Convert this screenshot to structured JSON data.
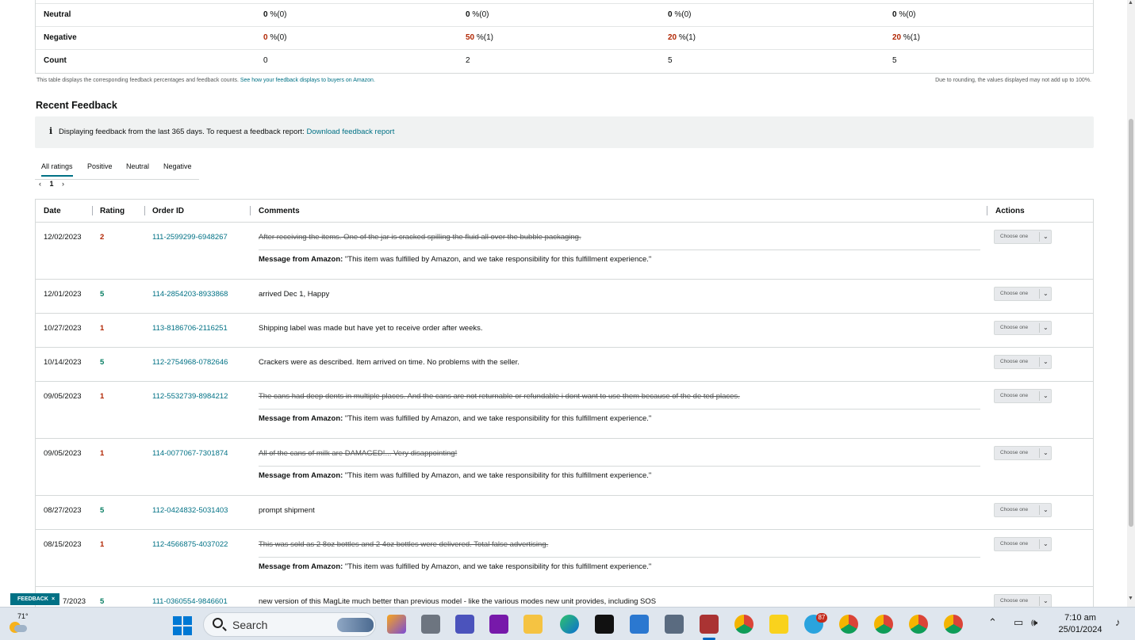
{
  "summary": {
    "rows": [
      {
        "label": "Neutral",
        "cells": [
          {
            "num": "0",
            "rest": " %(0)",
            "neg": false
          },
          {
            "num": "0",
            "rest": " %(0)",
            "neg": false
          },
          {
            "num": "0",
            "rest": " %(0)",
            "neg": false
          },
          {
            "num": "0",
            "rest": " %(0)",
            "neg": false
          }
        ]
      },
      {
        "label": "Negative",
        "cells": [
          {
            "num": "0",
            "rest": " %(0)",
            "neg": true
          },
          {
            "num": "50",
            "rest": " %(1)",
            "neg": true
          },
          {
            "num": "20",
            "rest": " %(1)",
            "neg": true
          },
          {
            "num": "20",
            "rest": " %(1)",
            "neg": true
          }
        ]
      },
      {
        "label": "Count",
        "cells": [
          {
            "num": "0",
            "rest": "",
            "neg": false
          },
          {
            "num": "2",
            "rest": "",
            "neg": false
          },
          {
            "num": "5",
            "rest": "",
            "neg": false
          },
          {
            "num": "5",
            "rest": "",
            "neg": false
          }
        ]
      }
    ],
    "note_left": "This table displays the corresponding feedback percentages and feedback counts.",
    "note_left_link": "See how your feedback displays to buyers on Amazon.",
    "note_right": "Due to rounding, the values displayed may not add up to 100%."
  },
  "recent": {
    "title": "Recent Feedback",
    "info_text": "Displaying feedback from the last 365 days. To request a feedback report:",
    "info_link": "Download feedback report",
    "tabs": [
      "All ratings",
      "Positive",
      "Neutral",
      "Negative"
    ],
    "active_tab": "All ratings",
    "pager": {
      "prev": "‹",
      "page": "1",
      "next": "›"
    }
  },
  "table": {
    "headers": {
      "date": "Date",
      "rating": "Rating",
      "order": "Order ID",
      "comments": "Comments",
      "actions": "Actions"
    },
    "action_label": "Choose one",
    "message_label": "Message from Amazon:",
    "rows": [
      {
        "date": "12/02/2023",
        "rating": "2",
        "order": "111-2599299-6948267",
        "comment": "After receiving the items. One of the jar is cracked spilling the fluid all over the bubble packaging.",
        "struck": true,
        "message": "\"This item was fulfilled by Amazon, and we take responsibility for this fulfillment experience.\""
      },
      {
        "date": "12/01/2023",
        "rating": "5",
        "order": "114-2854203-8933868",
        "comment": "arrived Dec 1, Happy",
        "struck": false,
        "message": ""
      },
      {
        "date": "10/27/2023",
        "rating": "1",
        "order": "113-8186706-2116251",
        "comment": "Shipping label was made but have yet to receive order after weeks.",
        "struck": false,
        "message": ""
      },
      {
        "date": "10/14/2023",
        "rating": "5",
        "order": "112-2754968-0782646",
        "comment": "Crackers were as described. Item arrived on time. No problems with the seller.",
        "struck": false,
        "message": ""
      },
      {
        "date": "09/05/2023",
        "rating": "1",
        "order": "112-5532739-8984212",
        "comment": "The cans had deep dents in multiple places. And the cans are not returnable or refundable i dont want to use them because of the de ted places.",
        "struck": true,
        "message": "\"This item was fulfilled by Amazon, and we take responsibility for this fulfillment experience.\""
      },
      {
        "date": "09/05/2023",
        "rating": "1",
        "order": "114-0077067-7301874",
        "comment": "All of the cans of milk are DAMAGED!... Very disappointing!",
        "struck": true,
        "message": "\"This item was fulfilled by Amazon, and we take responsibility for this fulfillment experience.\""
      },
      {
        "date": "08/27/2023",
        "rating": "5",
        "order": "112-0424832-5031403",
        "comment": "prompt shipment",
        "struck": false,
        "message": ""
      },
      {
        "date": "08/15/2023",
        "rating": "1",
        "order": "112-4566875-4037022",
        "comment": "This was sold as 2 8oz bottles and 2 4oz bottles were delivered. Total false advertising.",
        "struck": true,
        "message": "\"This item was fulfilled by Amazon, and we take responsibility for this fulfillment experience.\""
      },
      {
        "date": "7/2023",
        "rating": "5",
        "order": "111-0360554-9846601",
        "comment": "new version of this MagLite much better than previous model - like the various modes new unit provides, including SOS",
        "struck": false,
        "message": ""
      }
    ]
  },
  "feedback_tab": {
    "label": "FEEDBACK",
    "close": "×"
  },
  "taskbar": {
    "temperature": "71°",
    "search_placeholder": "Search",
    "badge_count": "87",
    "time": "7:10 am",
    "date": "25/01/2024",
    "colors": {
      "start": "#0078d4",
      "accent": "#0067c0"
    }
  },
  "colors": {
    "link": "#007185",
    "negative": "#b12704",
    "positive": "#067d62"
  }
}
